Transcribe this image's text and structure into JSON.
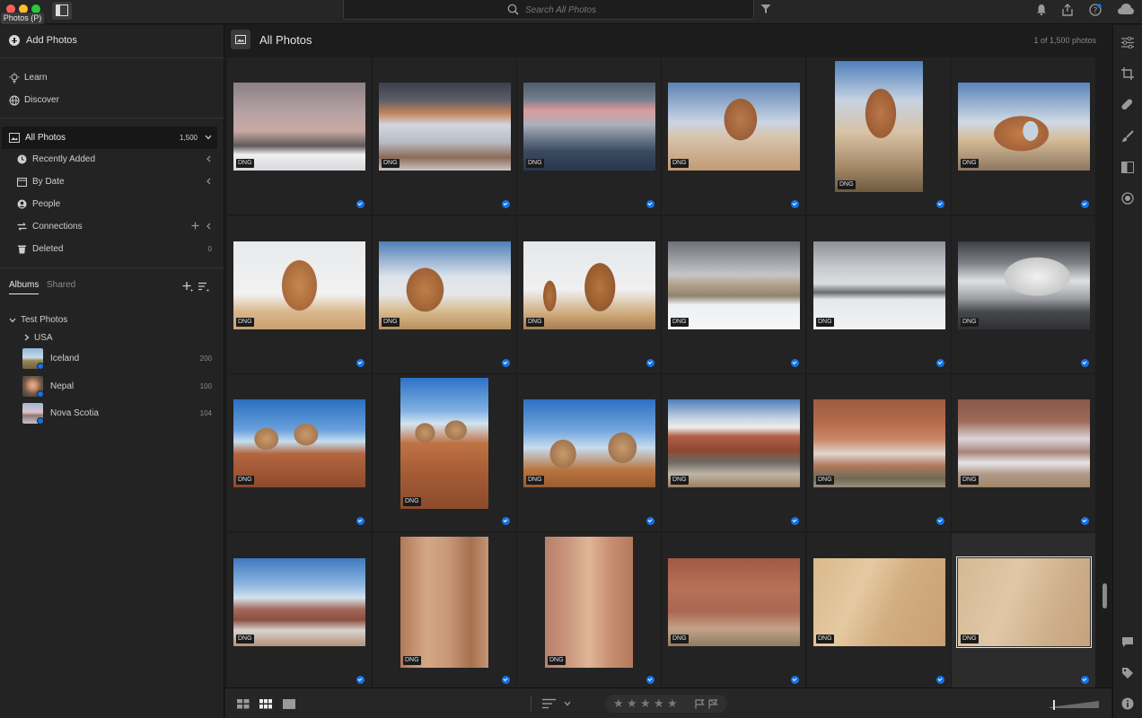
{
  "window": {
    "app_badge": "Photos (P)"
  },
  "search": {
    "placeholder": "Search All Photos"
  },
  "sidebar": {
    "add_photos": "Add Photos",
    "learn": "Learn",
    "discover": "Discover",
    "all_photos": {
      "label": "All Photos",
      "count": "1,500"
    },
    "recently_added": "Recently Added",
    "by_date": "By Date",
    "people": "People",
    "connections": "Connections",
    "deleted": {
      "label": "Deleted",
      "count": "0"
    }
  },
  "albums": {
    "tab_albums": "Albums",
    "tab_shared": "Shared",
    "group": "Test Photos",
    "folder": "USA",
    "items": [
      {
        "label": "Iceland",
        "count": "200"
      },
      {
        "label": "Nepal",
        "count": "100"
      },
      {
        "label": "Nova Scotia",
        "count": "104"
      }
    ]
  },
  "main": {
    "title": "All Photos",
    "count": "1 of 1,500 photos",
    "file_type": "DNG"
  },
  "colors": {
    "accent": "#1473e6",
    "background": "#1c1c1c",
    "panel": "#232323"
  }
}
